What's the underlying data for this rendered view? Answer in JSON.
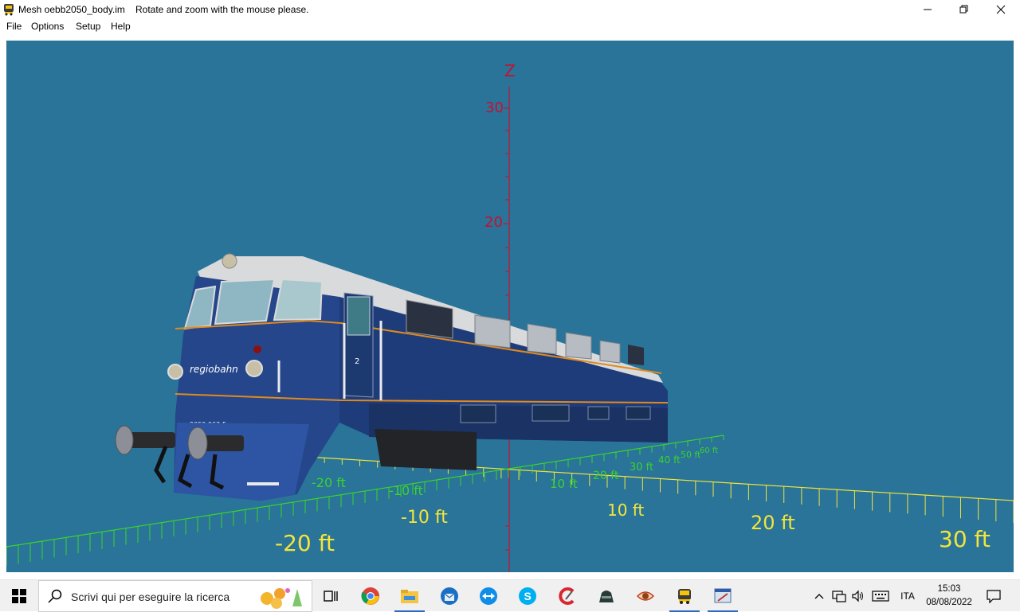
{
  "window": {
    "title": "Mesh oebb2050_body.im",
    "message": "Rotate and zoom with the mouse please."
  },
  "menu": {
    "items": [
      {
        "label": "File"
      },
      {
        "label": "Options"
      },
      {
        "label": "Setup"
      },
      {
        "label": "Help"
      }
    ]
  },
  "viewport": {
    "background": "#2a7399",
    "z_axis": {
      "label": "Z",
      "ticks": [
        "30",
        "20"
      ]
    },
    "floor_labels_yellow": [
      "-20 ft",
      "-10 ft",
      "10 ft",
      "20 ft",
      "30 ft"
    ],
    "floor_labels_green": [
      "-20 ft",
      "-10 ft",
      "10 ft",
      "20 ft",
      "30 ft",
      "40 ft",
      "50 ft",
      "60 ft"
    ],
    "model": {
      "brand": "regiobahn",
      "number_plate": "2050 063-5",
      "door_number": "2"
    }
  },
  "taskbar": {
    "search_placeholder": "Scrivi qui per eseguire la ricerca",
    "language": "ITA",
    "time": "15:03",
    "date": "08/08/2022",
    "pinned_icons": [
      "task-view-icon",
      "chrome-icon",
      "file-explorer-icon",
      "thunderbird-icon",
      "teamviewer-icon",
      "skype-icon",
      "ccleaner-icon",
      "hat-app-icon",
      "eye-app-icon",
      "train-app-icon",
      "editor-app-icon"
    ]
  }
}
